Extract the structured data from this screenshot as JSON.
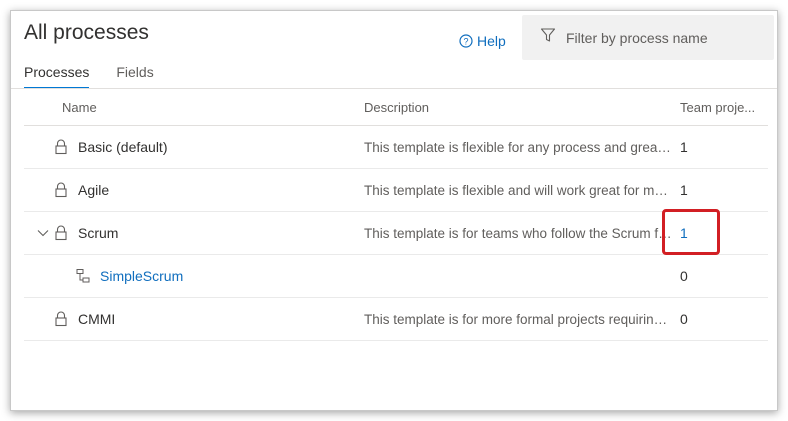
{
  "header": {
    "title": "All processes",
    "help_label": "Help",
    "filter_placeholder": "Filter by process name"
  },
  "tabs": [
    {
      "label": "Processes",
      "active": true
    },
    {
      "label": "Fields",
      "active": false
    }
  ],
  "grid": {
    "columns": {
      "name": "Name",
      "description": "Description",
      "team_projects": "Team proje..."
    },
    "rows": [
      {
        "name": "Basic (default)",
        "description": "This template is flexible for any process and great for teams getting started",
        "team_projects": "1"
      },
      {
        "name": "Agile",
        "description": "This template is flexible and will work great for most teams",
        "team_projects": "1"
      },
      {
        "name": "Scrum",
        "description": "This template is for teams who follow the Scrum framework",
        "team_projects": "1"
      },
      {
        "name": "SimpleScrum",
        "description": "",
        "team_projects": "0"
      },
      {
        "name": "CMMI",
        "description": "This template is for more formal projects requiring a framework",
        "team_projects": "0"
      }
    ]
  },
  "colors": {
    "accent": "#0078d4",
    "link": "#106ebe",
    "highlight": "#d21f24"
  }
}
